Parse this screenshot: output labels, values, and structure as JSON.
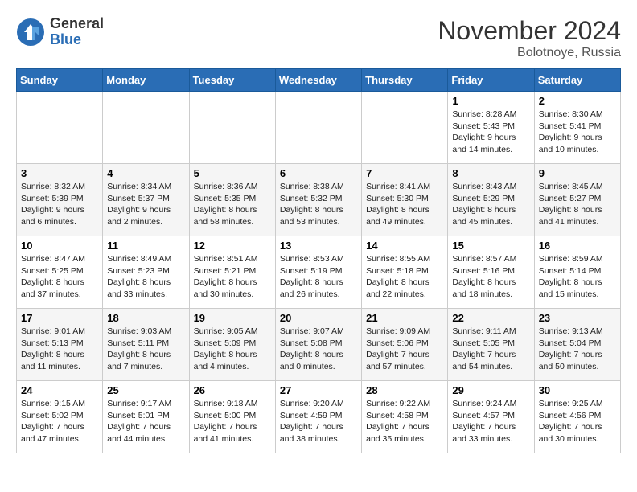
{
  "logo": {
    "general": "General",
    "blue": "Blue"
  },
  "title": "November 2024",
  "location": "Bolotnoye, Russia",
  "days_of_week": [
    "Sunday",
    "Monday",
    "Tuesday",
    "Wednesday",
    "Thursday",
    "Friday",
    "Saturday"
  ],
  "weeks": [
    [
      {
        "day": "",
        "info": ""
      },
      {
        "day": "",
        "info": ""
      },
      {
        "day": "",
        "info": ""
      },
      {
        "day": "",
        "info": ""
      },
      {
        "day": "",
        "info": ""
      },
      {
        "day": "1",
        "info": "Sunrise: 8:28 AM\nSunset: 5:43 PM\nDaylight: 9 hours and 14 minutes."
      },
      {
        "day": "2",
        "info": "Sunrise: 8:30 AM\nSunset: 5:41 PM\nDaylight: 9 hours and 10 minutes."
      }
    ],
    [
      {
        "day": "3",
        "info": "Sunrise: 8:32 AM\nSunset: 5:39 PM\nDaylight: 9 hours and 6 minutes."
      },
      {
        "day": "4",
        "info": "Sunrise: 8:34 AM\nSunset: 5:37 PM\nDaylight: 9 hours and 2 minutes."
      },
      {
        "day": "5",
        "info": "Sunrise: 8:36 AM\nSunset: 5:35 PM\nDaylight: 8 hours and 58 minutes."
      },
      {
        "day": "6",
        "info": "Sunrise: 8:38 AM\nSunset: 5:32 PM\nDaylight: 8 hours and 53 minutes."
      },
      {
        "day": "7",
        "info": "Sunrise: 8:41 AM\nSunset: 5:30 PM\nDaylight: 8 hours and 49 minutes."
      },
      {
        "day": "8",
        "info": "Sunrise: 8:43 AM\nSunset: 5:29 PM\nDaylight: 8 hours and 45 minutes."
      },
      {
        "day": "9",
        "info": "Sunrise: 8:45 AM\nSunset: 5:27 PM\nDaylight: 8 hours and 41 minutes."
      }
    ],
    [
      {
        "day": "10",
        "info": "Sunrise: 8:47 AM\nSunset: 5:25 PM\nDaylight: 8 hours and 37 minutes."
      },
      {
        "day": "11",
        "info": "Sunrise: 8:49 AM\nSunset: 5:23 PM\nDaylight: 8 hours and 33 minutes."
      },
      {
        "day": "12",
        "info": "Sunrise: 8:51 AM\nSunset: 5:21 PM\nDaylight: 8 hours and 30 minutes."
      },
      {
        "day": "13",
        "info": "Sunrise: 8:53 AM\nSunset: 5:19 PM\nDaylight: 8 hours and 26 minutes."
      },
      {
        "day": "14",
        "info": "Sunrise: 8:55 AM\nSunset: 5:18 PM\nDaylight: 8 hours and 22 minutes."
      },
      {
        "day": "15",
        "info": "Sunrise: 8:57 AM\nSunset: 5:16 PM\nDaylight: 8 hours and 18 minutes."
      },
      {
        "day": "16",
        "info": "Sunrise: 8:59 AM\nSunset: 5:14 PM\nDaylight: 8 hours and 15 minutes."
      }
    ],
    [
      {
        "day": "17",
        "info": "Sunrise: 9:01 AM\nSunset: 5:13 PM\nDaylight: 8 hours and 11 minutes."
      },
      {
        "day": "18",
        "info": "Sunrise: 9:03 AM\nSunset: 5:11 PM\nDaylight: 8 hours and 7 minutes."
      },
      {
        "day": "19",
        "info": "Sunrise: 9:05 AM\nSunset: 5:09 PM\nDaylight: 8 hours and 4 minutes."
      },
      {
        "day": "20",
        "info": "Sunrise: 9:07 AM\nSunset: 5:08 PM\nDaylight: 8 hours and 0 minutes."
      },
      {
        "day": "21",
        "info": "Sunrise: 9:09 AM\nSunset: 5:06 PM\nDaylight: 7 hours and 57 minutes."
      },
      {
        "day": "22",
        "info": "Sunrise: 9:11 AM\nSunset: 5:05 PM\nDaylight: 7 hours and 54 minutes."
      },
      {
        "day": "23",
        "info": "Sunrise: 9:13 AM\nSunset: 5:04 PM\nDaylight: 7 hours and 50 minutes."
      }
    ],
    [
      {
        "day": "24",
        "info": "Sunrise: 9:15 AM\nSunset: 5:02 PM\nDaylight: 7 hours and 47 minutes."
      },
      {
        "day": "25",
        "info": "Sunrise: 9:17 AM\nSunset: 5:01 PM\nDaylight: 7 hours and 44 minutes."
      },
      {
        "day": "26",
        "info": "Sunrise: 9:18 AM\nSunset: 5:00 PM\nDaylight: 7 hours and 41 minutes."
      },
      {
        "day": "27",
        "info": "Sunrise: 9:20 AM\nSunset: 4:59 PM\nDaylight: 7 hours and 38 minutes."
      },
      {
        "day": "28",
        "info": "Sunrise: 9:22 AM\nSunset: 4:58 PM\nDaylight: 7 hours and 35 minutes."
      },
      {
        "day": "29",
        "info": "Sunrise: 9:24 AM\nSunset: 4:57 PM\nDaylight: 7 hours and 33 minutes."
      },
      {
        "day": "30",
        "info": "Sunrise: 9:25 AM\nSunset: 4:56 PM\nDaylight: 7 hours and 30 minutes."
      }
    ]
  ]
}
